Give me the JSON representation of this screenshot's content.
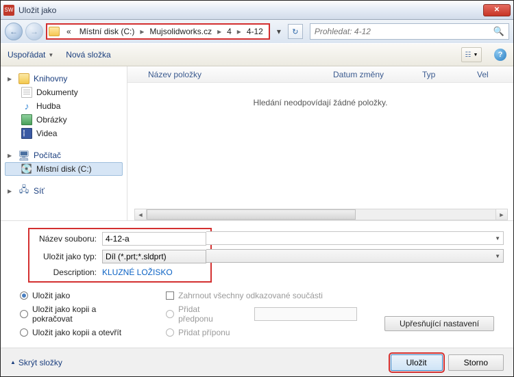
{
  "window": {
    "title": "Uložit jako"
  },
  "breadcrumb": {
    "chevron": "«",
    "items": [
      "Místní disk (C:)",
      "Mujsolidworks.cz",
      "4",
      "4-12"
    ]
  },
  "search": {
    "placeholder": "Prohledat: 4-12"
  },
  "toolbar": {
    "organize": "Uspořádat",
    "newfolder": "Nová složka"
  },
  "columns": {
    "name": "Název položky",
    "date": "Datum změny",
    "type": "Typ",
    "size": "Vel"
  },
  "empty": "Hledání neodpovídají žádné položky.",
  "tree": {
    "libraries": "Knihovny",
    "documents": "Dokumenty",
    "music": "Hudba",
    "pictures": "Obrázky",
    "videos": "Videa",
    "computer": "Počítač",
    "localdisk": "Místní disk (C:)",
    "network": "Síť"
  },
  "form": {
    "filename_label": "Název souboru:",
    "filename": "4-12-a",
    "type_label": "Uložit jako typ:",
    "type": "Díl (*.prt;*.sldprt)",
    "desc_label": "Description:",
    "desc": "KLUZNÉ LOŽISKO"
  },
  "options": {
    "saveas": "Uložit jako",
    "saveascopy_continue": "Uložit jako kopii a pokračovat",
    "saveascopy_open": "Uložit jako kopii a otevřít",
    "include_refs": "Zahrnout všechny odkazované součásti",
    "add_prefix": "Přidat předponu",
    "add_suffix": "Přidat příponu",
    "advanced": "Upřesňující nastavení"
  },
  "footer": {
    "hide_folders": "Skrýt složky",
    "save": "Uložit",
    "cancel": "Storno"
  }
}
